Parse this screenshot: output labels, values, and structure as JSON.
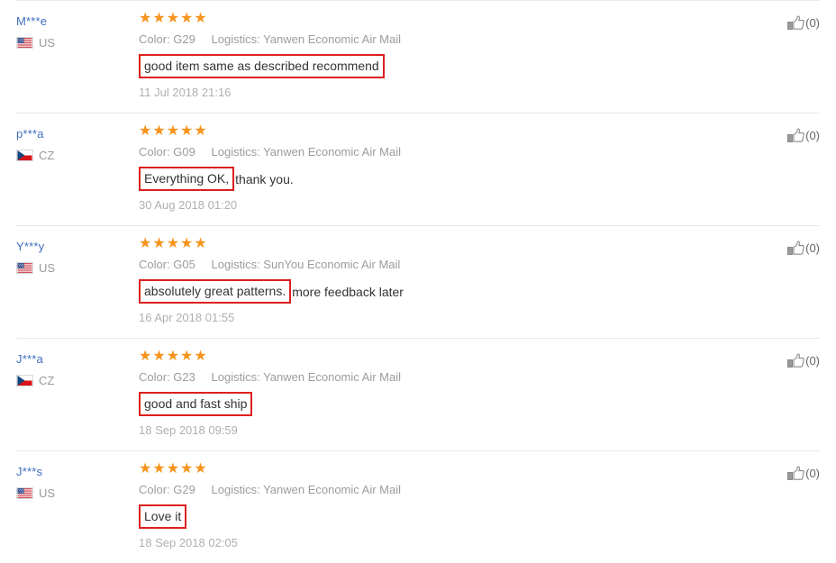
{
  "page": {
    "accent_star_color": "#f7941d",
    "username_color": "#3f6ebf",
    "highlight_box_color": "#dd1f1f",
    "divider_color": "#e8e8e8"
  },
  "reviews": [
    {
      "username": "M***e",
      "country_code": "US",
      "country_flag": "us-flag-icon",
      "rating": 5,
      "color_label": "Color: G29",
      "logistics_label": "Logistics: Yanwen Economic Air Mail",
      "comment_highlighted": "good item same as described recommend",
      "comment_rest": "",
      "date": "11 Jul 2018 21:16",
      "helpful_icon": "thumbs-up-icon",
      "helpful_count": "(0)"
    },
    {
      "username": "p***a",
      "country_code": "CZ",
      "country_flag": "cz-flag-icon",
      "rating": 5,
      "color_label": "Color: G09",
      "logistics_label": "Logistics: Yanwen Economic Air Mail",
      "comment_highlighted": "Everything OK,",
      "comment_rest": "thank you.",
      "date": "30 Aug 2018 01:20",
      "helpful_icon": "thumbs-up-icon",
      "helpful_count": "(0)"
    },
    {
      "username": "Y***y",
      "country_code": "US",
      "country_flag": "us-flag-icon",
      "rating": 5,
      "color_label": "Color: G05",
      "logistics_label": "Logistics: SunYou Economic Air Mail",
      "comment_highlighted": "absolutely great patterns.",
      "comment_rest": "more feedback later",
      "date": "16 Apr 2018 01:55",
      "helpful_icon": "thumbs-up-icon",
      "helpful_count": "(0)"
    },
    {
      "username": "J***a",
      "country_code": "CZ",
      "country_flag": "cz-flag-icon",
      "rating": 5,
      "color_label": "Color: G23",
      "logistics_label": "Logistics: Yanwen Economic Air Mail",
      "comment_highlighted": "good and fast ship",
      "comment_rest": "",
      "date": "18 Sep 2018 09:59",
      "helpful_icon": "thumbs-up-icon",
      "helpful_count": "(0)"
    },
    {
      "username": "J***s",
      "country_code": "US",
      "country_flag": "us-flag-icon",
      "rating": 5,
      "color_label": "Color: G29",
      "logistics_label": "Logistics: Yanwen Economic Air Mail",
      "comment_highlighted": "Love it",
      "comment_rest": "",
      "date": "18 Sep 2018 02:05",
      "helpful_icon": "thumbs-up-icon",
      "helpful_count": "(0)"
    }
  ]
}
